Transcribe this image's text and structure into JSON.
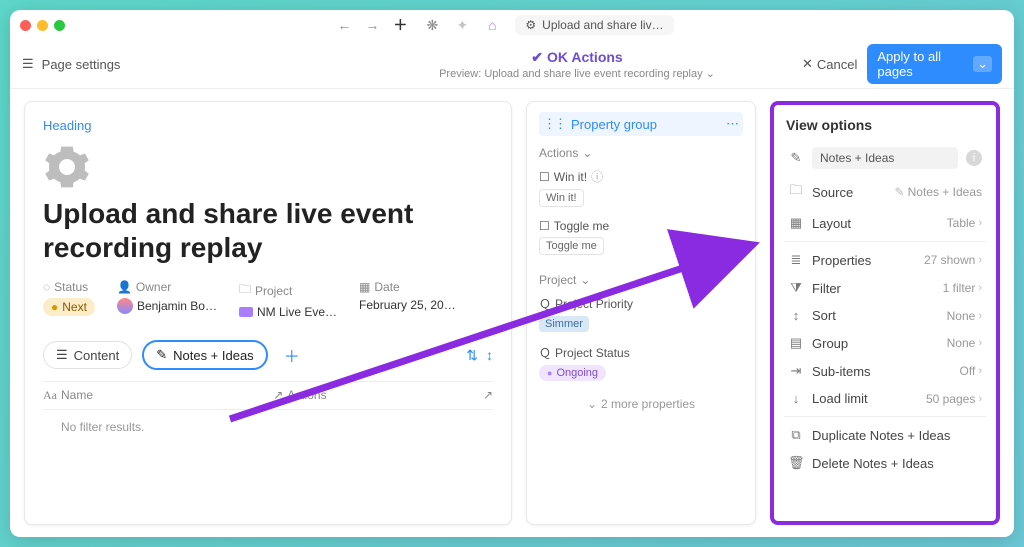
{
  "titlebar": {
    "tab_label": "Upload and share liv…"
  },
  "toolbar": {
    "page_settings": "Page settings",
    "ok_title": "OK Actions",
    "preview": "Preview: Upload and share live event recording replay",
    "cancel": "Cancel",
    "apply": "Apply to all pages"
  },
  "page": {
    "heading_label": "Heading",
    "title": "Upload and share live event recording replay",
    "props": {
      "status_label": "Status",
      "status_value": "Next",
      "owner_label": "Owner",
      "owner_value": "Benjamin Bo…",
      "project_label": "Project",
      "project_value": "NM Live Eve…",
      "date_label": "Date",
      "date_value": "February 25, 20…"
    },
    "tabs": {
      "content": "Content",
      "notes": "Notes + Ideas"
    },
    "table": {
      "name": "Name",
      "actions": "Actions",
      "empty": "No filter results."
    }
  },
  "pg": {
    "title": "Property group",
    "actions": "Actions",
    "win_label": "Win it!",
    "win_chip": "Win it!",
    "toggle_label": "Toggle me",
    "toggle_chip": "Toggle me",
    "project": "Project",
    "priority_label": "Project Priority",
    "priority_value": "Simmer",
    "status_label": "Project Status",
    "status_value": "Ongoing",
    "more": "2 more properties"
  },
  "vo": {
    "title": "View options",
    "name": "Notes + Ideas",
    "rows": {
      "source": "Source",
      "source_val": "Notes + Ideas",
      "layout": "Layout",
      "layout_val": "Table",
      "properties": "Properties",
      "properties_val": "27 shown",
      "filter": "Filter",
      "filter_val": "1 filter",
      "sort": "Sort",
      "sort_val": "None",
      "group": "Group",
      "group_val": "None",
      "subitems": "Sub-items",
      "subitems_val": "Off",
      "load": "Load limit",
      "load_val": "50 pages",
      "duplicate": "Duplicate Notes + Ideas",
      "delete": "Delete Notes + Ideas"
    }
  }
}
